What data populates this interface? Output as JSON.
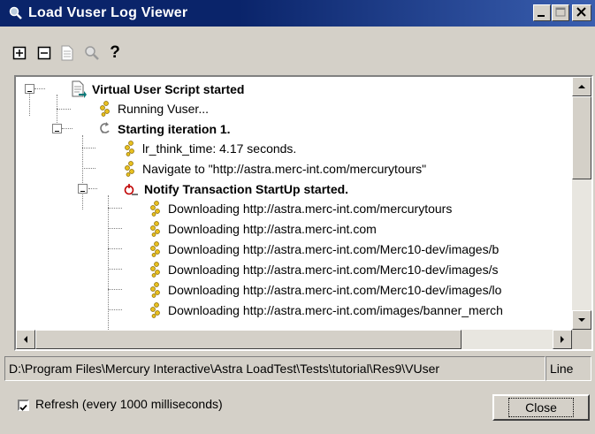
{
  "window": {
    "title": "Load Vuser Log Viewer"
  },
  "toolbar": {
    "buttons": [
      {
        "icon": "expand-all-icon"
      },
      {
        "icon": "collapse-all-icon"
      },
      {
        "icon": "document-icon"
      },
      {
        "icon": "find-icon"
      },
      {
        "icon": "help-icon",
        "glyph": "?"
      }
    ]
  },
  "tree": {
    "nodes": [
      {
        "label": "Virtual User Script started",
        "bold": true,
        "icon": "script-icon",
        "expander": "minus"
      },
      {
        "label": "Running Vuser...",
        "bold": false,
        "icon": "vuser-icon"
      },
      {
        "label": "Starting iteration 1.",
        "bold": true,
        "icon": "iteration-icon",
        "expander": "minus"
      },
      {
        "label": "lr_think_time: 4.17 seconds.",
        "bold": false,
        "icon": "vuser-icon"
      },
      {
        "label": "Navigate to  \"http://astra.merc-int.com/mercurytours\"",
        "bold": false,
        "icon": "vuser-icon"
      },
      {
        "label": "Notify Transaction StartUp started.",
        "bold": true,
        "icon": "transaction-icon",
        "expander": "minus"
      },
      {
        "label": "Downloading http://astra.merc-int.com/mercurytours",
        "bold": false,
        "icon": "vuser-icon"
      },
      {
        "label": "Downloading http://astra.merc-int.com",
        "bold": false,
        "icon": "vuser-icon"
      },
      {
        "label": "Downloading http://astra.merc-int.com/Merc10-dev/images/b",
        "bold": false,
        "icon": "vuser-icon"
      },
      {
        "label": "Downloading http://astra.merc-int.com/Merc10-dev/images/s",
        "bold": false,
        "icon": "vuser-icon"
      },
      {
        "label": "Downloading http://astra.merc-int.com/Merc10-dev/images/lo",
        "bold": false,
        "icon": "vuser-icon"
      },
      {
        "label": "Downloading http://astra.merc-int.com/images/banner_merch",
        "bold": false,
        "icon": "vuser-icon"
      }
    ]
  },
  "status": {
    "path": "D:\\Program Files\\Mercury Interactive\\Astra LoadTest\\Tests\\tutorial\\Res9\\VUser",
    "line": "Line"
  },
  "refresh": {
    "checked": true,
    "label": "Refresh (every 1000 milliseconds)"
  },
  "close_button": {
    "label": "Close"
  },
  "colors": {
    "titlebar": "#0a246a",
    "face": "#d4d0c8",
    "tree_bg": "#ffffff"
  }
}
